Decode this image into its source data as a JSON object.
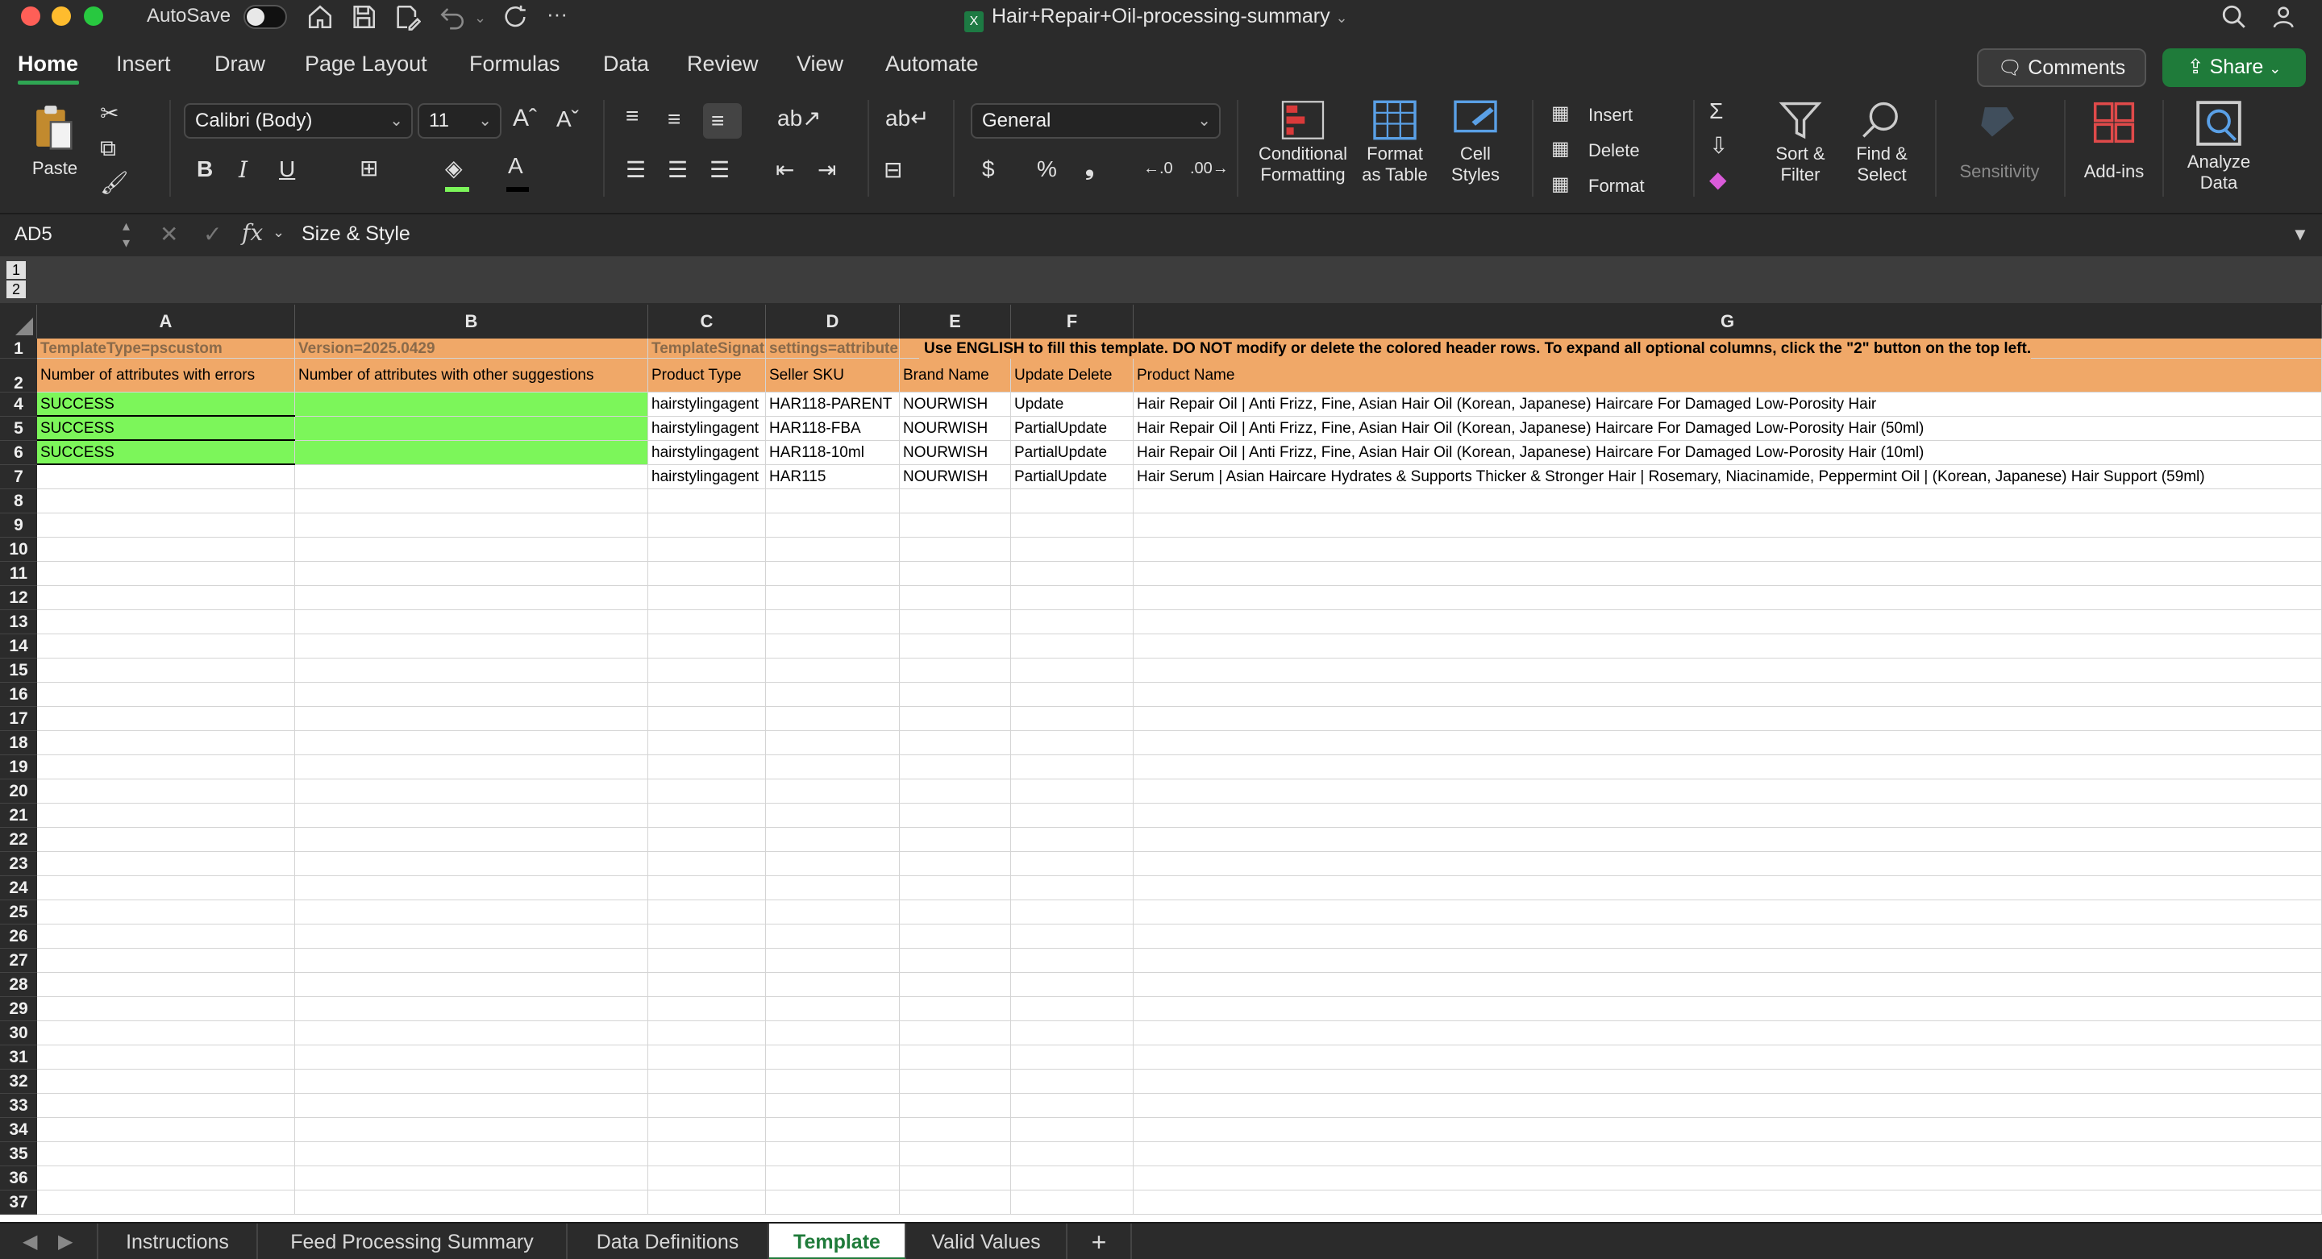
{
  "window": {
    "title": "Hair+Repair+Oil-processing-summary",
    "autosave_label": "AutoSave"
  },
  "ribbon_tabs": [
    "Home",
    "Insert",
    "Draw",
    "Page Layout",
    "Formulas",
    "Data",
    "Review",
    "View",
    "Automate"
  ],
  "actions": {
    "comments": "Comments",
    "share": "Share"
  },
  "ribbon": {
    "paste": "Paste",
    "font_name": "Calibri (Body)",
    "font_size": "11",
    "number_format": "General",
    "conditional_formatting": [
      "Conditional",
      "Formatting"
    ],
    "format_as_table": [
      "Format",
      "as Table"
    ],
    "cell_styles": [
      "Cell",
      "Styles"
    ],
    "insert": "Insert",
    "delete": "Delete",
    "format": "Format",
    "sort_filter": [
      "Sort &",
      "Filter"
    ],
    "find_select": [
      "Find &",
      "Select"
    ],
    "sensitivity": "Sensitivity",
    "add_ins": "Add-ins",
    "analyze_data": [
      "Analyze",
      "Data"
    ],
    "bold": "B",
    "italic": "I",
    "underline": "U"
  },
  "formula_bar": {
    "cell_ref": "AD5",
    "fx": "fx",
    "content": "Size & Style"
  },
  "outline_levels": [
    "1",
    "2"
  ],
  "columns": [
    "A",
    "B",
    "C",
    "D",
    "E",
    "F",
    "G"
  ],
  "row_numbers": [
    "1",
    "2",
    "4",
    "5",
    "6",
    "7",
    "8",
    "9",
    "10",
    "11",
    "12",
    "13",
    "14",
    "15",
    "16",
    "17",
    "18",
    "19",
    "20",
    "21",
    "22",
    "23",
    "24",
    "25",
    "26",
    "27",
    "28",
    "29",
    "30",
    "31",
    "32",
    "33",
    "34",
    "35",
    "36",
    "37"
  ],
  "row1": {
    "a": "TemplateType=pscustom",
    "b": "Version=2025.0429",
    "c": "TemplateSignature",
    "d": "settings=attribute",
    "g": "Use ENGLISH to fill this template. DO NOT modify or delete the colored header rows. To expand all optional columns, click the \"2\" button on the top left."
  },
  "row2": {
    "a": "Number of attributes with errors",
    "b": "Number of attributes with other suggestions",
    "c": "Product Type",
    "d": "Seller SKU",
    "e": "Brand Name",
    "f": "Update Delete",
    "g": "Product Name"
  },
  "data_rows": [
    {
      "a": "SUCCESS",
      "c": "hairstylingagent",
      "d": "HAR118-PARENT",
      "e": "NOURWISH",
      "f": "Update",
      "g": "Hair Repair Oil | Anti Frizz, Fine, Asian Hair Oil (Korean, Japanese) Haircare For Damaged Low-Porosity Hair"
    },
    {
      "a": "SUCCESS",
      "c": "hairstylingagent",
      "d": "HAR118-FBA",
      "e": "NOURWISH",
      "f": "PartialUpdate",
      "g": "Hair Repair Oil | Anti Frizz, Fine, Asian Hair Oil (Korean, Japanese) Haircare For Damaged Low-Porosity Hair (50ml)"
    },
    {
      "a": "SUCCESS",
      "c": "hairstylingagent",
      "d": "HAR118-10ml",
      "e": "NOURWISH",
      "f": "PartialUpdate",
      "g": "Hair Repair Oil | Anti Frizz, Fine, Asian Hair Oil (Korean, Japanese) Haircare For Damaged Low-Porosity Hair (10ml)"
    },
    {
      "a": "",
      "c": "hairstylingagent",
      "d": "HAR115",
      "e": "NOURWISH",
      "f": "PartialUpdate",
      "g": "Hair Serum | Asian Haircare Hydrates & Supports Thicker & Stronger Hair | Rosemary, Niacinamide, Peppermint Oil | (Korean, Japanese) Hair Support (59ml)"
    }
  ],
  "sheets": [
    "Instructions",
    "Feed Processing Summary",
    "Data Definitions",
    "Template",
    "Valid Values"
  ],
  "active_sheet": "Template",
  "colors": {
    "header_orange": "#f0a868",
    "success_green": "#7cf65a",
    "accent": "#1f7b3a"
  }
}
